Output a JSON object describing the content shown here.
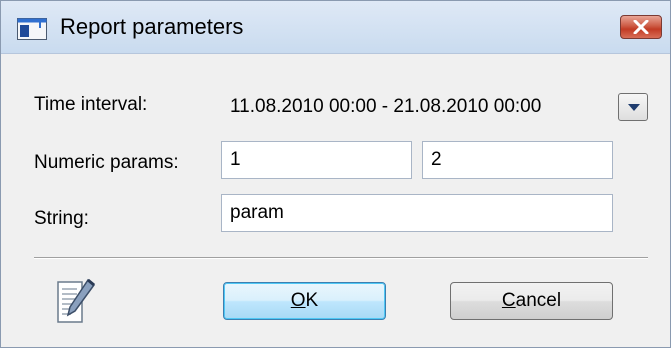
{
  "window": {
    "title": "Report parameters",
    "icon": "report-window-icon",
    "close_icon": "close-icon"
  },
  "form": {
    "time_interval_label": "Time interval:",
    "time_interval_value": "11.08.2010 00:00 - 21.08.2010 00:00",
    "numeric_params_label": "Numeric params:",
    "numeric_param_1": "1",
    "numeric_param_2": "2",
    "string_label": "String:",
    "string_value": "param"
  },
  "footer": {
    "doc_icon": "document-edit-icon",
    "ok_mnemonic": "O",
    "ok_rest": "K",
    "cancel_mnemonic": "C",
    "cancel_rest": "ancel"
  },
  "colors": {
    "window_bg": "#f0f0f0",
    "titlebar": "#c9dbef",
    "close_button": "#c23b24",
    "default_button_border": "#3c7fb1"
  }
}
